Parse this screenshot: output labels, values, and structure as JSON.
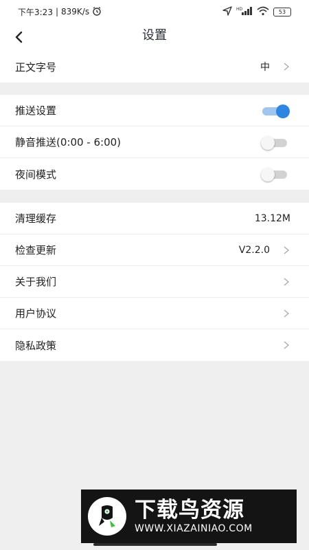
{
  "status_bar": {
    "time": "下午3:23",
    "net_speed": "839K/s",
    "battery": "53",
    "network": "HD"
  },
  "header": {
    "title": "设置"
  },
  "groups": [
    {
      "items": [
        {
          "label": "正文字号",
          "value": "中",
          "chevron": true
        }
      ]
    },
    {
      "items": [
        {
          "label": "推送设置",
          "toggle": true
        },
        {
          "label": "静音推送(0:00 - 6:00)",
          "toggle": false
        },
        {
          "label": "夜间模式",
          "toggle": false
        }
      ]
    },
    {
      "items": [
        {
          "label": "清理缓存",
          "value": "13.12M",
          "chevron": false
        },
        {
          "label": "检查更新",
          "value": "V2.2.0",
          "chevron": true
        },
        {
          "label": "关于我们",
          "value": "",
          "chevron": true
        },
        {
          "label": "用户协议",
          "value": "",
          "chevron": true
        },
        {
          "label": "隐私政策",
          "value": "",
          "chevron": true
        }
      ]
    }
  ],
  "watermark": {
    "title": "下载鸟资源",
    "url": "WWW.XIAZAINIAO.COM"
  },
  "colors": {
    "toggle_on": "#2f86e0",
    "toggle_on_track": "#9fc6ee",
    "background": "#efeff0"
  }
}
